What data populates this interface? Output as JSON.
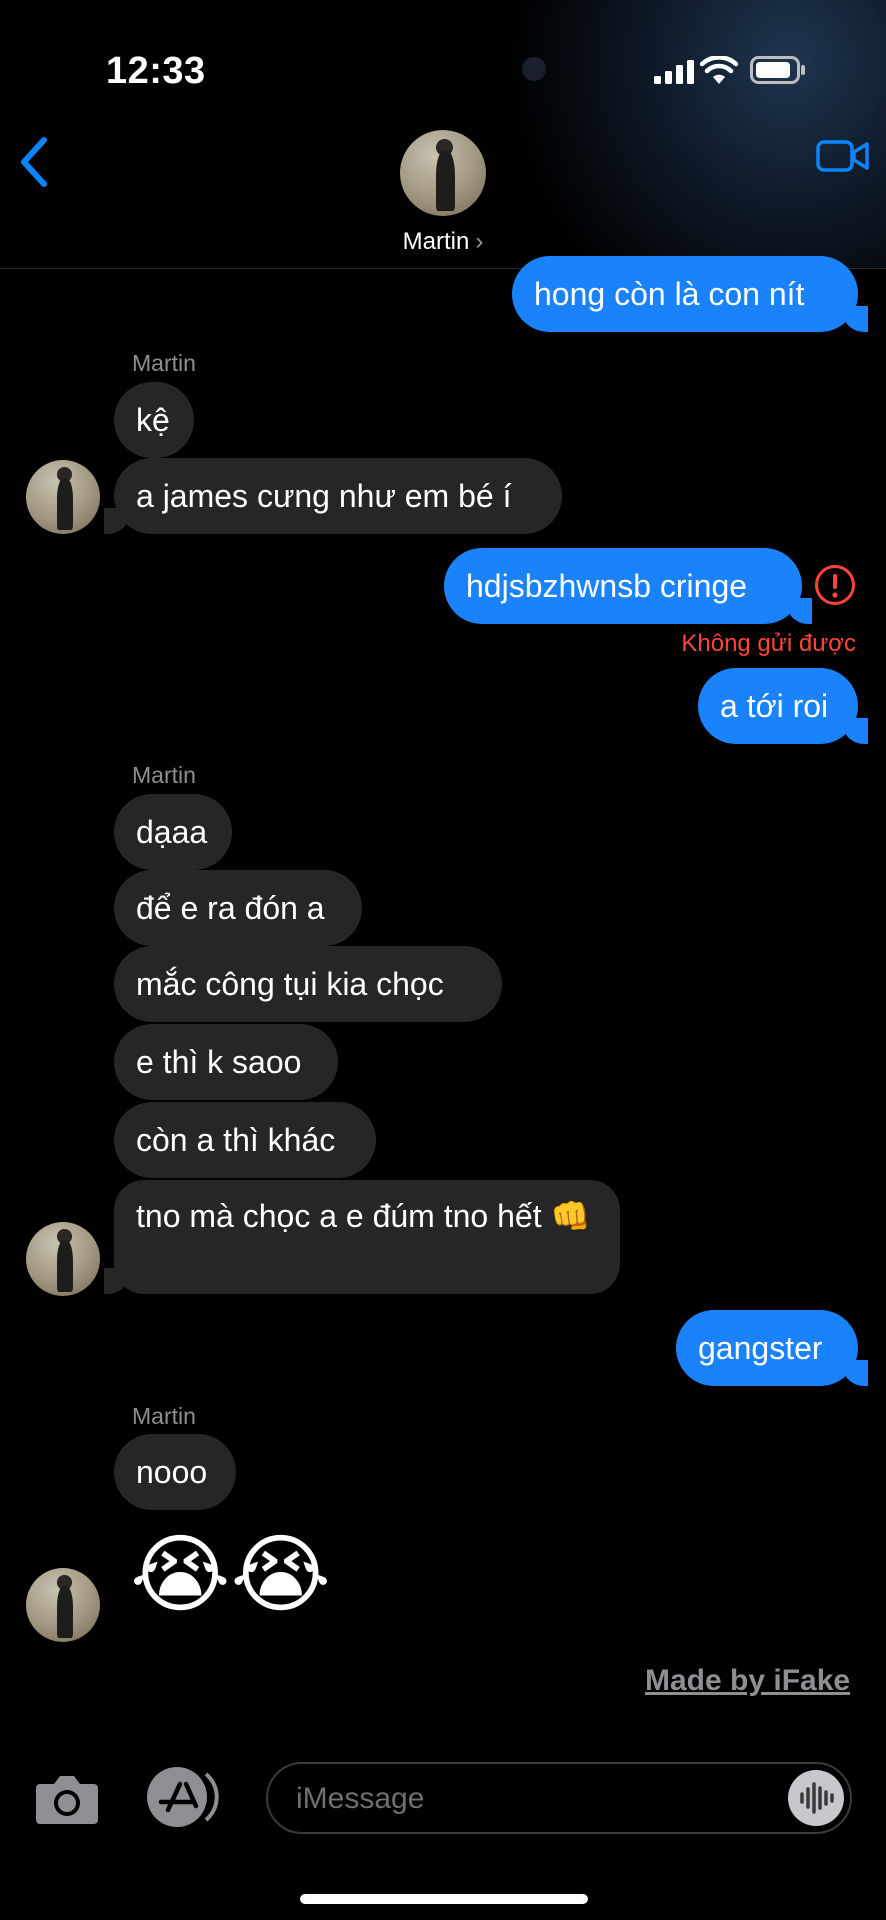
{
  "status_bar": {
    "time": "12:33"
  },
  "header": {
    "contact_name": "Martin",
    "chevron": "›"
  },
  "messages": {
    "m1": "hong còn là con nít",
    "label1": "Martin",
    "m2": "kệ",
    "m3": "a james cưng như em bé í",
    "m4": "hdjsbzhwnsb cringe",
    "m4_error": "Không gửi được",
    "m5": "a tới roi",
    "label2": "Martin",
    "m6": "dạaa",
    "m7": "để e ra đón a",
    "m8": "mắc công tụi kia chọc",
    "m9": "e thì k saoo",
    "m10": "còn a thì khác",
    "m11": "tno mà chọc a e đúm tno hết 👊",
    "m12": "gangster",
    "label3": "Martin",
    "m13": "nooo",
    "m14": "😭😭"
  },
  "watermark": "Made by iFake",
  "input": {
    "placeholder": "iMessage"
  },
  "icons": {
    "back": "chevron-left-icon",
    "video": "video-camera-icon",
    "camera": "camera-icon",
    "apps": "app-store-icon",
    "mic": "audio-waveform-icon",
    "error": "exclamation-circle-icon"
  },
  "colors": {
    "sent_bubble": "#1a82fb",
    "received_bubble": "#262628",
    "accent": "#0a84ff",
    "error": "#ff453a"
  }
}
